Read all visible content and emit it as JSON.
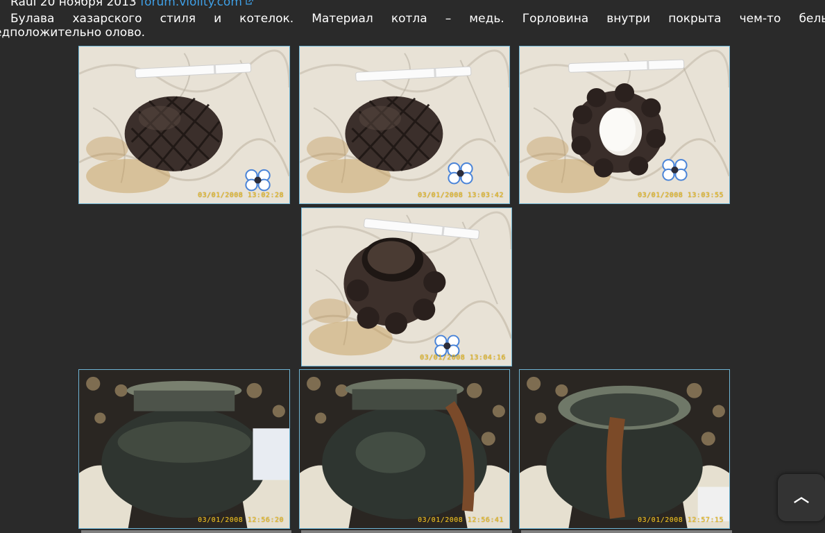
{
  "post": {
    "author": "Raul",
    "date": "20 ноября 2013",
    "source": "forum.violity.com",
    "description_line1_words": [
      "Булава",
      "хазарского",
      "стиля",
      "и",
      "котелок.",
      "Материал",
      "котла",
      "–",
      "медь.",
      "Горловина",
      "внутри",
      "покрыта",
      "чем-то",
      "белым,"
    ],
    "description_line2": "едположительно олово."
  },
  "photos": [
    {
      "stamp": "03/01/2008 13:02:28",
      "subject": "mace-side"
    },
    {
      "stamp": "03/01/2008 13:03:42",
      "subject": "mace-side"
    },
    {
      "stamp": "03/01/2008 13:03:55",
      "subject": "mace-top"
    },
    {
      "stamp": "03/01/2008 13:04:16",
      "subject": "mace-angle"
    },
    {
      "stamp": "03/01/2008 12:56:20",
      "subject": "pot-front"
    },
    {
      "stamp": "03/01/2008 12:56:41",
      "subject": "pot-side"
    },
    {
      "stamp": "03/01/2008 12:57:15",
      "subject": "pot-top"
    }
  ],
  "ui": {
    "scroll_top_icon": "chevron-up-icon",
    "scroll_top_glyph": "︿"
  },
  "colors": {
    "background": "#2a2a2a",
    "link": "#3fa0e6",
    "photo_border": "#6fb6d6",
    "stamp": "#f2c42a"
  }
}
